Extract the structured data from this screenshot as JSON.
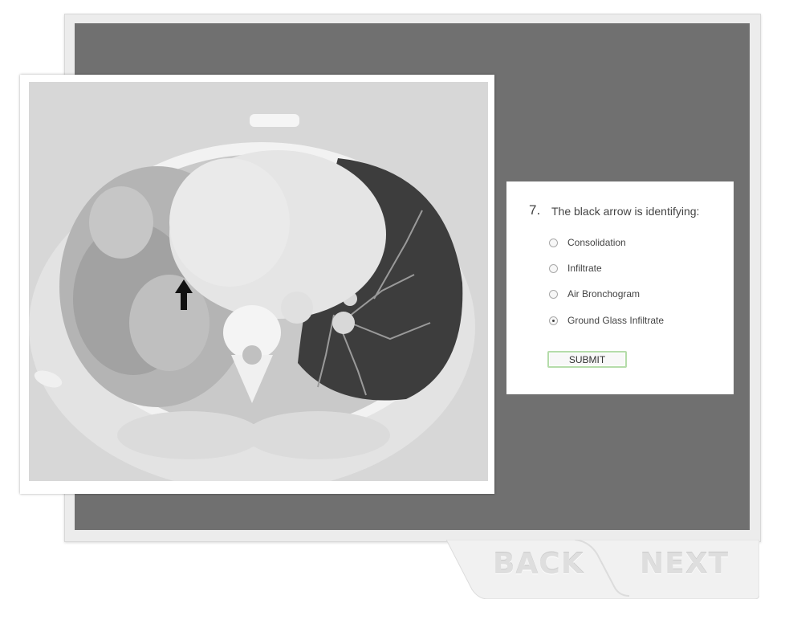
{
  "question": {
    "number": "7.",
    "text": "The black arrow is identifying:",
    "options": [
      {
        "label": "Consolidation",
        "selected": false
      },
      {
        "label": "Infiltrate",
        "selected": false
      },
      {
        "label": "Air Bronchogram",
        "selected": false
      },
      {
        "label": "Ground Glass Infiltrate",
        "selected": true
      }
    ],
    "submit_label": "SUBMIT"
  },
  "nav": {
    "back_label": "BACK",
    "next_label": "NEXT"
  },
  "colors": {
    "stage": "#707070",
    "submit_border": "#b5dcaa"
  }
}
